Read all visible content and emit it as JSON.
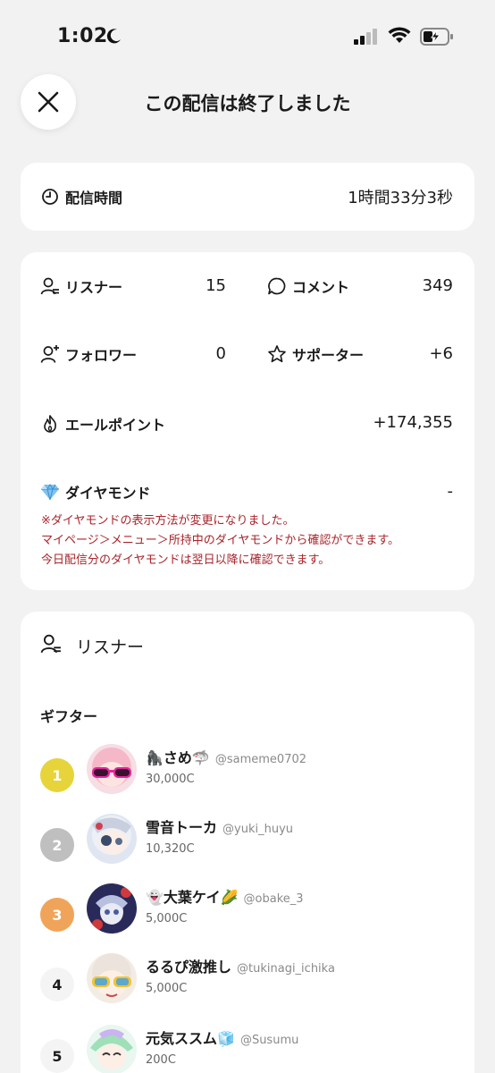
{
  "status_bar": {
    "time": "1:02"
  },
  "header": {
    "title": "この配信は終了しました"
  },
  "duration": {
    "label": "配信時間",
    "value": "1時間33分3秒"
  },
  "stats": {
    "listeners": {
      "label": "リスナー",
      "value": "15"
    },
    "comments": {
      "label": "コメント",
      "value": "349"
    },
    "followers": {
      "label": "フォロワー",
      "value": "0"
    },
    "supporters": {
      "label": "サポーター",
      "value": "+6"
    },
    "yell_points": {
      "label": "エールポイント",
      "value": "+174,355"
    },
    "diamonds": {
      "label": "ダイヤモンド",
      "value": "-"
    },
    "notice": [
      "※ダイヤモンドの表示方法が変更になりました。",
      "マイページ＞メニュー＞所持中のダイヤモンドから確認ができます。",
      "今日配信分のダイヤモンドは翌日以降に確認できます。"
    ]
  },
  "listeners_section": {
    "title": "リスナー",
    "gifter_heading": "ギフター",
    "gifters": [
      {
        "rank": "1",
        "name": "🦍さめ🦈",
        "handle": "@sameme0702",
        "coins": "30,000C"
      },
      {
        "rank": "2",
        "name": "雪音トーカ",
        "handle": "@yuki_huyu",
        "coins": "10,320C"
      },
      {
        "rank": "3",
        "name": "👻大葉ケイ🌽",
        "handle": "@obake_3",
        "coins": "5,000C"
      },
      {
        "rank": "4",
        "name": "るるぴ激推し",
        "handle": "@tukinagi_ichika",
        "coins": "5,000C"
      },
      {
        "rank": "5",
        "name": "元気ススム🧊",
        "handle": "@Susumu",
        "coins": "200C"
      }
    ]
  },
  "colors": {
    "rank1": "#e6d43a",
    "rank2": "#bfbfbf",
    "rank3": "#f0a45a",
    "notice": "#a8242a"
  }
}
